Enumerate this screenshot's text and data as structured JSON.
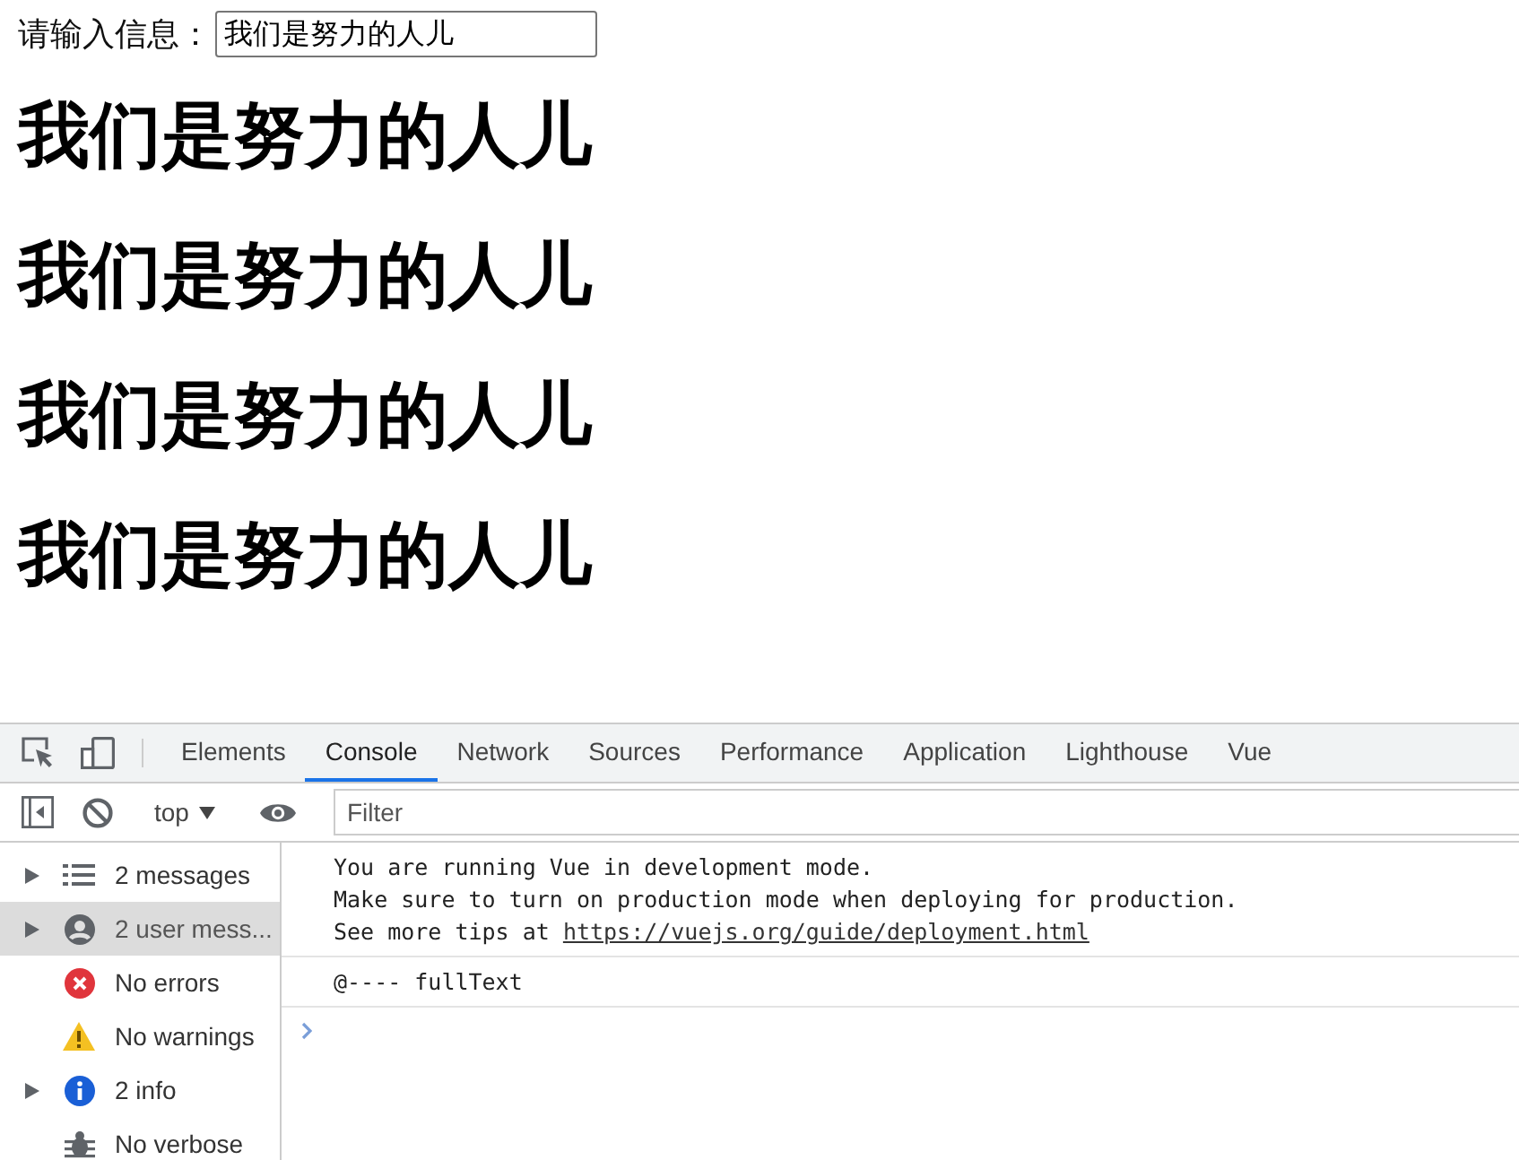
{
  "page": {
    "label": "请输入信息：",
    "input": {
      "value": "我们是努力的人儿"
    },
    "headings": [
      "我们是努力的人儿",
      "我们是努力的人儿",
      "我们是努力的人儿",
      "我们是努力的人儿"
    ]
  },
  "devtools": {
    "tabs": [
      {
        "label": "Elements",
        "selected": false
      },
      {
        "label": "Console",
        "selected": true
      },
      {
        "label": "Network",
        "selected": false
      },
      {
        "label": "Sources",
        "selected": false
      },
      {
        "label": "Performance",
        "selected": false
      },
      {
        "label": "Application",
        "selected": false
      },
      {
        "label": "Lighthouse",
        "selected": false
      },
      {
        "label": "Vue",
        "selected": false
      }
    ],
    "toolbar": {
      "context": "top",
      "filter": {
        "placeholder": "Filter"
      }
    },
    "sidebar": [
      {
        "kind": "messages",
        "label": "2 messages",
        "expandable": true,
        "selected": false
      },
      {
        "kind": "user",
        "label": "2 user mess...",
        "expandable": true,
        "selected": true
      },
      {
        "kind": "errors",
        "label": "No errors",
        "expandable": false,
        "selected": false
      },
      {
        "kind": "warnings",
        "label": "No warnings",
        "expandable": false,
        "selected": false
      },
      {
        "kind": "info",
        "label": "2 info",
        "expandable": true,
        "selected": false
      },
      {
        "kind": "verbose",
        "label": "No verbose",
        "expandable": false,
        "selected": false
      }
    ],
    "console": {
      "messages": [
        {
          "lines": [
            "You are running Vue in development mode.",
            "Make sure to turn on production mode when deploying for production."
          ],
          "tail": "See more tips at ",
          "link": "https://vuejs.org/guide/deployment.html"
        },
        {
          "lines": [
            "@---- fullText"
          ]
        }
      ]
    }
  }
}
